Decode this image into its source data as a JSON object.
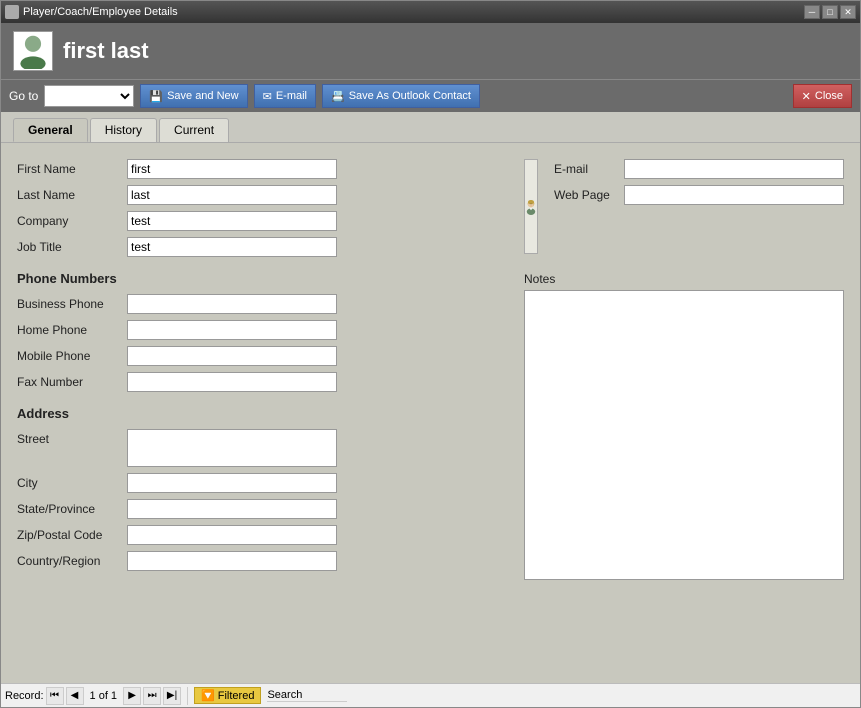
{
  "window": {
    "title": "Player/Coach/Employee Details",
    "controls": [
      "minimize",
      "maximize",
      "close"
    ]
  },
  "header": {
    "icon": "person-icon",
    "title": "first last"
  },
  "toolbar": {
    "goto_label": "Go to",
    "goto_placeholder": "",
    "save_new_label": "Save and New",
    "email_label": "E-mail",
    "save_outlook_label": "Save As Outlook Contact",
    "close_label": "Close"
  },
  "tabs": [
    {
      "id": "general",
      "label": "General",
      "active": true
    },
    {
      "id": "history",
      "label": "History",
      "active": false
    },
    {
      "id": "current",
      "label": "Current",
      "active": false
    }
  ],
  "form": {
    "first_name_label": "First Name",
    "first_name_value": "first",
    "last_name_label": "Last Name",
    "last_name_value": "last",
    "company_label": "Company",
    "company_value": "test",
    "job_title_label": "Job Title",
    "job_title_value": "test",
    "phone_section": "Phone Numbers",
    "business_phone_label": "Business Phone",
    "business_phone_value": "",
    "home_phone_label": "Home Phone",
    "home_phone_value": "",
    "mobile_phone_label": "Mobile Phone",
    "mobile_phone_value": "",
    "fax_number_label": "Fax Number",
    "fax_number_value": "",
    "address_section": "Address",
    "street_label": "Street",
    "street_value": "",
    "city_label": "City",
    "city_value": "",
    "state_label": "State/Province",
    "state_value": "",
    "zip_label": "Zip/Postal Code",
    "zip_value": "",
    "country_label": "Country/Region",
    "country_value": "",
    "email_label": "E-mail",
    "email_value": "",
    "webpage_label": "Web Page",
    "webpage_value": "",
    "notes_label": "Notes",
    "notes_value": ""
  },
  "status_bar": {
    "record_label": "Record:",
    "first_btn": "⏮",
    "prev_btn": "◀",
    "record_of": "1 of 1",
    "next_btn": "▶",
    "last_btn": "⏭",
    "new_btn": "⏭|",
    "filtered_icon": "🔽",
    "filtered_label": "Filtered",
    "search_placeholder": "Search",
    "search_value": "Search"
  }
}
